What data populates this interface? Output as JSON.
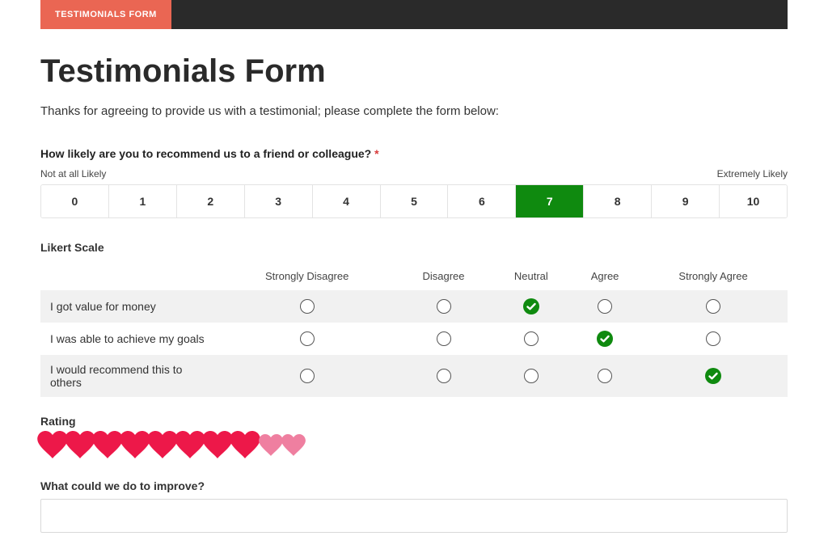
{
  "topbar": {
    "tab": "TESTIMONIALS FORM"
  },
  "title": "Testimonials Form",
  "intro": "Thanks for agreeing to provide us with a testimonial; please complete the form below:",
  "nps": {
    "question": "How likely are you to recommend us to a friend or colleague?",
    "required_mark": "*",
    "low_label": "Not at all Likely",
    "high_label": "Extremely Likely",
    "options": [
      "0",
      "1",
      "2",
      "3",
      "4",
      "5",
      "6",
      "7",
      "8",
      "9",
      "10"
    ],
    "selected": "7"
  },
  "likert": {
    "title": "Likert Scale",
    "columns": [
      "Strongly Disagree",
      "Disagree",
      "Neutral",
      "Agree",
      "Strongly Agree"
    ],
    "rows": [
      {
        "label": "I got value for money",
        "selected": 2
      },
      {
        "label": "I was able to achieve my goals",
        "selected": 3
      },
      {
        "label": "I would recommend this to others",
        "selected": 4
      }
    ]
  },
  "rating": {
    "label": "Rating",
    "total": 10,
    "filled": 8,
    "filled_color": "#ed1849",
    "empty_color": "#ef7fa0"
  },
  "improve": {
    "label": "What could we do to improve?",
    "value": ""
  }
}
